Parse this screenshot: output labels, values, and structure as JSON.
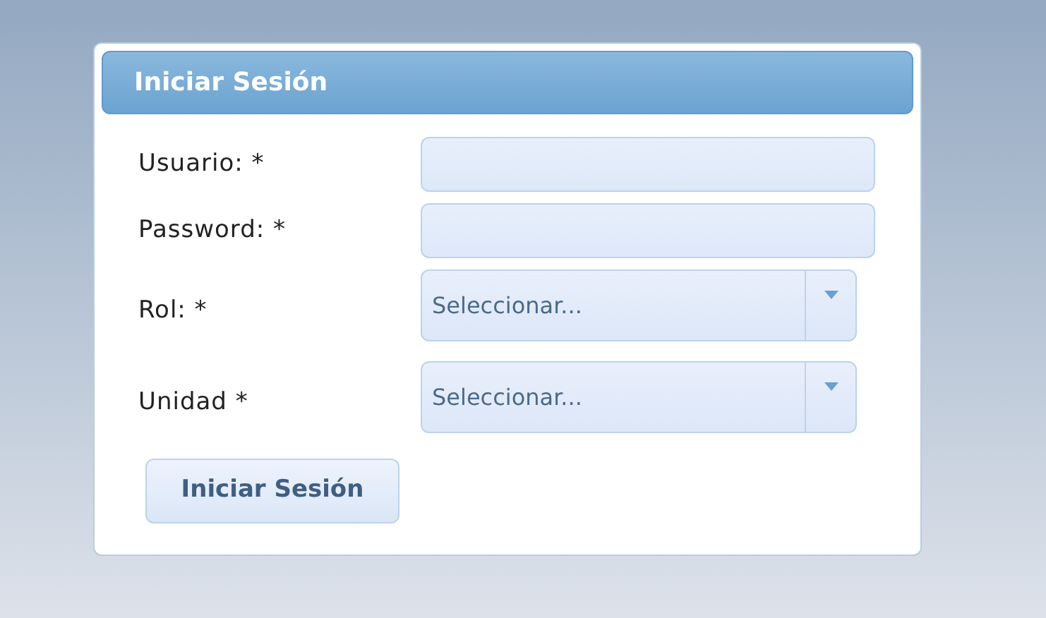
{
  "panel": {
    "title": "Iniciar Sesión"
  },
  "fields": [
    {
      "kind": "text",
      "label": "Usuario: *"
    },
    {
      "kind": "text",
      "label": "Password: *"
    },
    {
      "kind": "select",
      "label": "Rol: *",
      "value": "Seleccionar..."
    },
    {
      "kind": "select",
      "label": "Unidad *",
      "value": "Seleccionar..."
    }
  ],
  "submit_button": "Iniciar Sesión"
}
